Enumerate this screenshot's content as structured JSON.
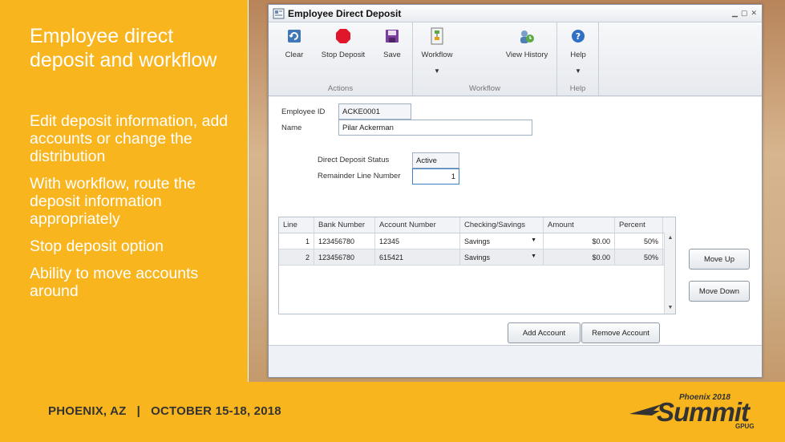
{
  "slide": {
    "title": "Employee direct deposit and workflow",
    "bullets": [
      "Edit deposit information, add accounts or change the distribution",
      "With workflow, route the deposit information appropriately",
      "Stop deposit option",
      "Ability to move accounts around"
    ]
  },
  "footer": {
    "event": "PHOENIX, AZ   |   OCTOBER 15-18, 2018",
    "logo_top": "Phoenix 2018",
    "logo_main": "Summit",
    "logo_sub": "GPUG"
  },
  "window": {
    "title": "Employee Direct Deposit",
    "controls": [
      "▁",
      "▢",
      "✕"
    ]
  },
  "ribbon": {
    "groups": [
      {
        "label": "Actions",
        "buttons": [
          "Clear",
          "Stop Deposit",
          "Save"
        ]
      },
      {
        "label": "Workflow",
        "buttons": [
          "Workflow",
          "View History"
        ]
      },
      {
        "label": "Help",
        "buttons": [
          "Help"
        ]
      }
    ]
  },
  "form": {
    "employee_id_label": "Employee ID",
    "employee_id": "ACKE0001",
    "name_label": "Name",
    "name": "Pilar Ackerman",
    "status_label": "Direct Deposit Status",
    "status": "Active",
    "remainder_label": "Remainder Line Number",
    "remainder": "1"
  },
  "grid": {
    "columns": [
      "Line",
      "Bank Number",
      "Account Number",
      "Checking/Savings",
      "Amount",
      "Percent"
    ],
    "rows": [
      {
        "line": "1",
        "bank": "123456780",
        "account": "12345",
        "type": "Savings",
        "amount": "$0.00",
        "percent": "50%"
      },
      {
        "line": "2",
        "bank": "123456780",
        "account": "615421",
        "type": "Savings",
        "amount": "$0.00",
        "percent": "50%"
      }
    ]
  },
  "buttons": {
    "move_up": "Move Up",
    "move_down": "Move Down",
    "add_account": "Add Account",
    "remove_account": "Remove Account"
  }
}
